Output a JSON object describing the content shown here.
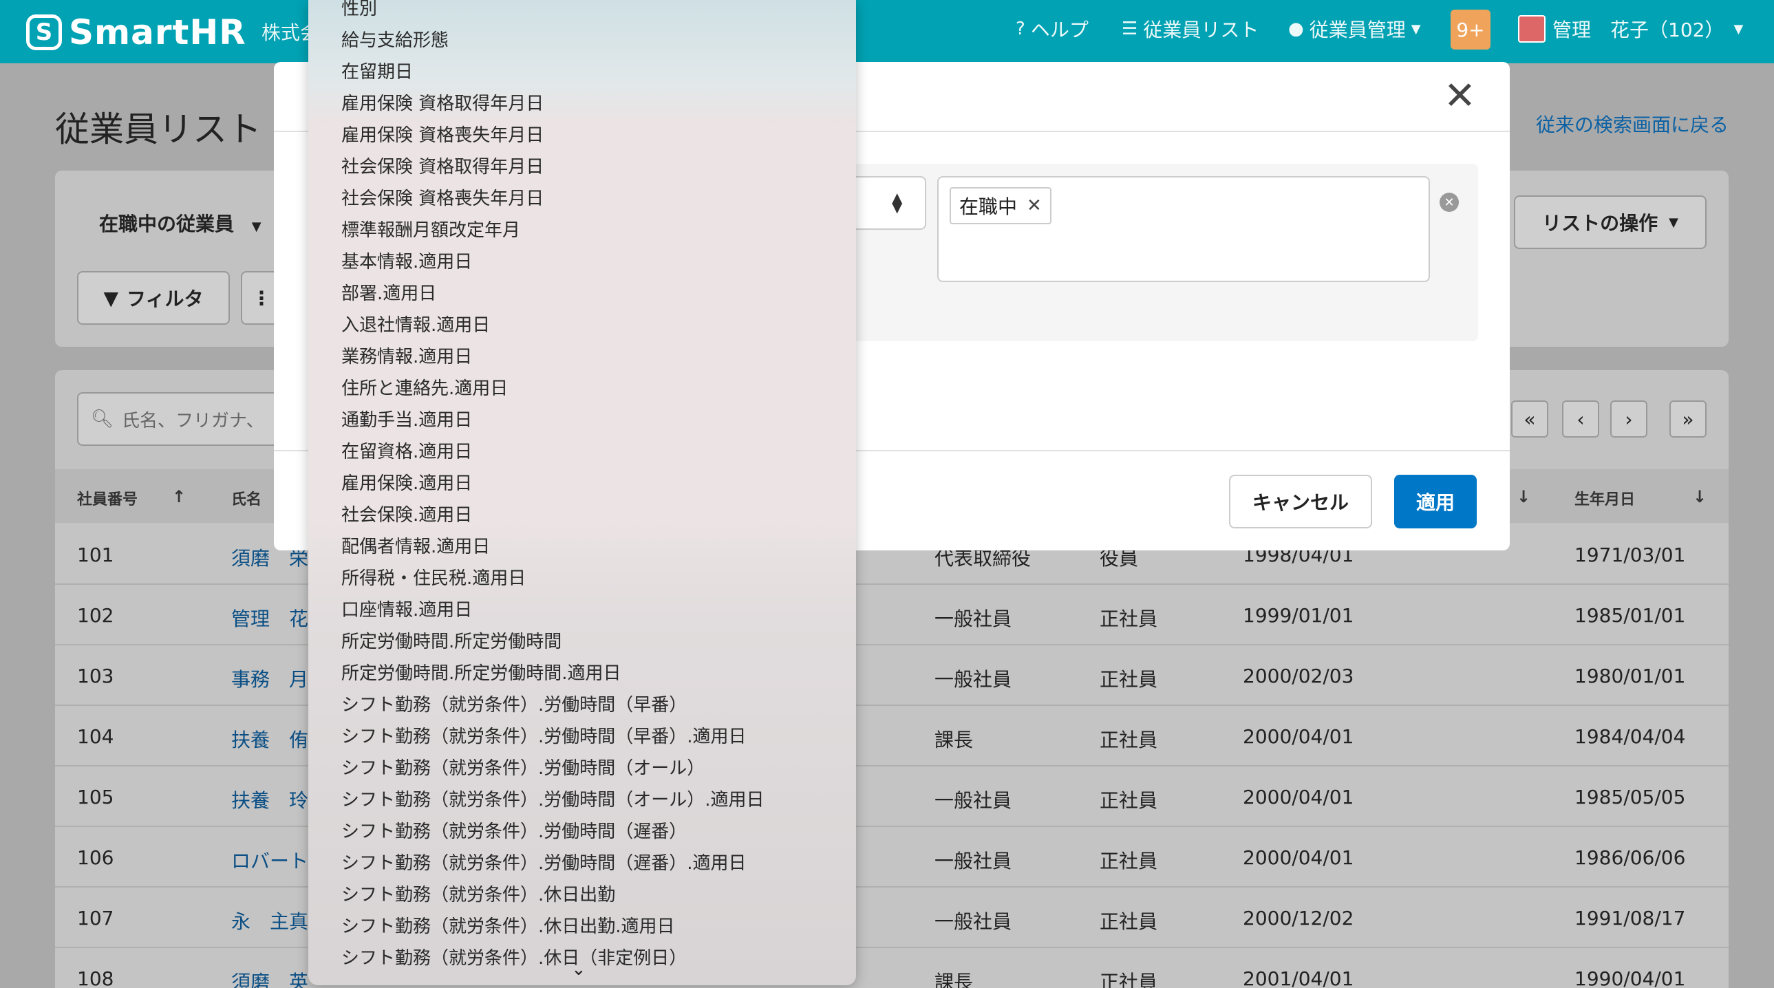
{
  "header": {
    "logo": "SmartHR",
    "company": "株式会",
    "help": "ヘルプ",
    "employee_list": "従業員リスト",
    "employee_mgmt": "従業員管理",
    "notifications": "9+",
    "user": "管理　花子（102）"
  },
  "page": {
    "title": "従業員リスト",
    "back_link": "従来の検索画面に戻る",
    "filter_label": "在職中の従業員",
    "filter_button": "フィルタ",
    "list_ops": "リストの操作",
    "search_placeholder": "氏名、フリガナ、"
  },
  "table": {
    "headers": [
      "社員番号",
      "氏名",
      "生年月日"
    ],
    "rows": [
      {
        "id": "101",
        "name": "須磨　栄",
        "position": "代表取締役",
        "type": "役員",
        "date": "1998/04/01",
        "birth": "1971/03/01"
      },
      {
        "id": "102",
        "name": "管理　花",
        "position": "一般社員",
        "type": "正社員",
        "date": "1999/01/01",
        "birth": "1985/01/01"
      },
      {
        "id": "103",
        "name": "事務　月",
        "position": "一般社員",
        "type": "正社員",
        "date": "2000/02/03",
        "birth": "1980/01/01"
      },
      {
        "id": "104",
        "name": "扶養　侑",
        "position": "課長",
        "type": "正社員",
        "date": "2000/04/01",
        "birth": "1984/04/04"
      },
      {
        "id": "105",
        "name": "扶養　玲",
        "position": "一般社員",
        "type": "正社員",
        "date": "2000/04/01",
        "birth": "1985/05/05"
      },
      {
        "id": "106",
        "name": "ロバート",
        "position": "一般社員",
        "type": "正社員",
        "date": "2000/04/01",
        "birth": "1986/06/06"
      },
      {
        "id": "107",
        "name": "永　主真",
        "position": "一般社員",
        "type": "正社員",
        "date": "2000/12/02",
        "birth": "1991/08/17"
      },
      {
        "id": "108",
        "name": "須磨　英",
        "position": "課長",
        "type": "正社員",
        "date": "2001/04/01",
        "birth": "1990/04/01"
      }
    ]
  },
  "modal": {
    "tag": "在職中",
    "cancel": "キャンセル",
    "apply": "適用"
  },
  "dropdown": {
    "items": [
      "性別",
      "給与支給形態",
      "在留期日",
      "雇用保険 資格取得年月日",
      "雇用保険 資格喪失年月日",
      "社会保険 資格取得年月日",
      "社会保険 資格喪失年月日",
      "標準報酬月額改定年月",
      "基本情報.適用日",
      "部署.適用日",
      "入退社情報.適用日",
      "業務情報.適用日",
      "住所と連絡先.適用日",
      "通勤手当.適用日",
      "在留資格.適用日",
      "雇用保険.適用日",
      "社会保険.適用日",
      "配偶者情報.適用日",
      "所得税・住民税.適用日",
      "口座情報.適用日",
      "所定労働時間.所定労働時間",
      "所定労働時間.所定労働時間.適用日",
      "シフト勤務（就労条件）.労働時間（早番）",
      "シフト勤務（就労条件）.労働時間（早番）.適用日",
      "シフト勤務（就労条件）.労働時間（オール）",
      "シフト勤務（就労条件）.労働時間（オール）.適用日",
      "シフト勤務（就労条件）.労働時間（遅番）",
      "シフト勤務（就労条件）.労働時間（遅番）.適用日",
      "シフト勤務（就労条件）.休日出勤",
      "シフト勤務（就労条件）.休日出勤.適用日",
      "シフト勤務（就労条件）.休日（非定例日）"
    ]
  }
}
